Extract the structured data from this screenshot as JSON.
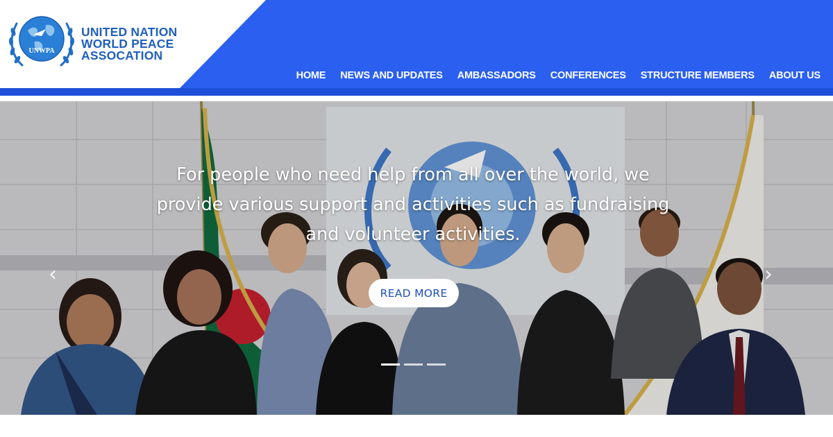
{
  "brand": {
    "logo_text": "UNWPA",
    "name_line1": "UNITED NATION",
    "name_line2": "WORLD PEACE",
    "name_line3": "ASSOCATION"
  },
  "nav": {
    "items": [
      {
        "label": "HOME"
      },
      {
        "label": "NEWS AND UPDATES"
      },
      {
        "label": "AMBASSADORS"
      },
      {
        "label": "CONFERENCES"
      },
      {
        "label": "STRUCTURE MEMBERS"
      },
      {
        "label": "ABOUT US"
      }
    ]
  },
  "hero": {
    "caption_line1": "For people who need help from all over the world, we",
    "caption_line2": "provide various support and activities such as fundraising",
    "caption_line3": "and volunteer activities.",
    "cta_label": "READ MORE",
    "prev_icon": "chevron-left-icon",
    "next_icon": "chevron-right-icon",
    "prev_glyph": "‹",
    "next_glyph": "›",
    "slide_count": 3,
    "active_slide": 1
  },
  "colors": {
    "header_blue": "#2a5ff0",
    "brand_text": "#1f5fbf",
    "cta_text": "#1f4fb8"
  }
}
